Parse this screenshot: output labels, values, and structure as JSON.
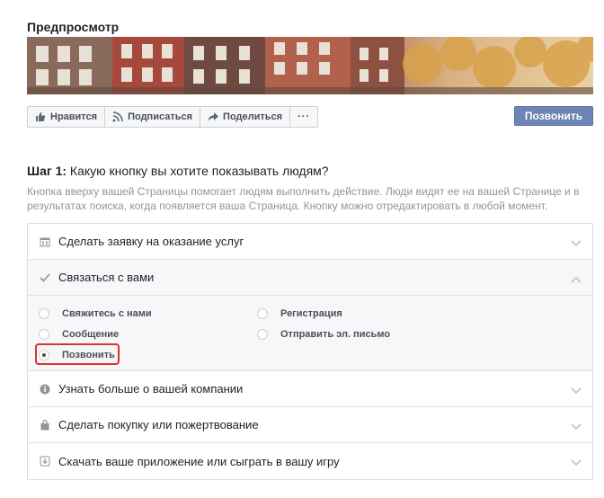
{
  "preview": {
    "title": "Предпросмотр"
  },
  "actionbar": {
    "like": "Нравится",
    "follow": "Подписаться",
    "share": "Поделиться",
    "more": "···"
  },
  "cta_button": "Позвонить",
  "step": {
    "label": "Шаг 1:",
    "question": "Какую кнопку вы хотите показывать людям?",
    "description": "Кнопка вверху вашей Страницы помогает людям выполнить действие. Люди видят ее на вашей Странице и в результатах поиска, когда появляется ваша Страница. Кнопку можно отредактировать в любой момент."
  },
  "categories": [
    {
      "label": "Сделать заявку на оказание услуг",
      "icon": "calendar-icon",
      "open": false
    },
    {
      "label": "Связаться с вами",
      "icon": "checkmark-icon",
      "open": true
    },
    {
      "label": "Узнать больше о вашей компании",
      "icon": "info-icon",
      "open": false
    },
    {
      "label": "Сделать покупку или пожертвование",
      "icon": "shopping-bag-icon",
      "open": false
    },
    {
      "label": "Скачать ваше приложение или сыграть в вашу игру",
      "icon": "download-icon",
      "open": false
    }
  ],
  "contact_options": [
    {
      "label": "Свяжитесь с нами",
      "selected": false
    },
    {
      "label": "Регистрация",
      "selected": false
    },
    {
      "label": "Сообщение",
      "selected": false
    },
    {
      "label": "Отправить эл. письмо",
      "selected": false
    },
    {
      "label": "Позвонить",
      "selected": true
    }
  ],
  "colors": {
    "accent": "#6d84b4",
    "highlight": "#e02f2f",
    "panel_bg": "#f6f7f9"
  }
}
